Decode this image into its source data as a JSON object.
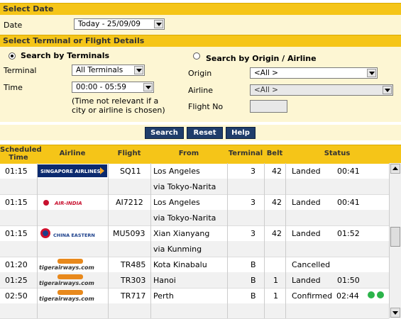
{
  "select_date": {
    "header": "Select Date",
    "date_label": "Date",
    "date_value": "Today - 25/09/09"
  },
  "terminal_section": {
    "header": "Select Terminal or Flight Details",
    "by_terminals_label": "Search by Terminals",
    "by_origin_label": "Search by Origin / Airline",
    "terminal_label": "Terminal",
    "terminal_value": "All Terminals",
    "time_label": "Time",
    "time_value": "00:00 - 05:59",
    "note_line1": "(Time not relevant if a",
    "note_line2": "city or airline is chosen)",
    "origin_label": "Origin",
    "origin_value": "<All >",
    "airline_label": "Airline",
    "airline_value": "<All >",
    "flight_no_label": "Flight No"
  },
  "buttons": {
    "search": "Search",
    "reset": "Reset",
    "help": "Help"
  },
  "table": {
    "headers": {
      "scheduled": "Scheduled",
      "time": "Time",
      "airline": "Airline",
      "flight": "Flight",
      "from": "From",
      "terminal": "Terminal",
      "belt": "Belt",
      "status": "Status"
    },
    "rows": [
      {
        "time": "01:15",
        "airline": "SINGAPORE AIRLINES",
        "flight": "SQ11",
        "from": "Los Angeles",
        "terminal": "3",
        "belt": "42",
        "status": "Landed",
        "status_time": "00:41"
      },
      {
        "via": "via Tokyo-Narita"
      },
      {
        "time": "01:15",
        "airline": "AIR-INDIA",
        "flight": "AI7212",
        "from": "Los Angeles",
        "terminal": "3",
        "belt": "42",
        "status": "Landed",
        "status_time": "00:41"
      },
      {
        "via": "via Tokyo-Narita"
      },
      {
        "time": "01:15",
        "airline": "CHINA EASTERN",
        "flight": "MU5093",
        "from": "Xian Xianyang",
        "terminal": "3",
        "belt": "42",
        "status": "Landed",
        "status_time": "01:52"
      },
      {
        "via": "via Kunming"
      },
      {
        "time": "01:20",
        "airline": "tigerairways.com",
        "flight": "TR485",
        "from": "Kota Kinabalu",
        "terminal": "B",
        "belt": "",
        "status": "Cancelled",
        "status_time": ""
      },
      {
        "time": "01:25",
        "airline": "tigerairways.com",
        "flight": "TR303",
        "from": "Hanoi",
        "terminal": "B",
        "belt": "1",
        "status": "Landed",
        "status_time": "01:50"
      },
      {
        "time": "02:50",
        "airline": "tigerairways.com",
        "flight": "TR717",
        "from": "Perth",
        "terminal": "B",
        "belt": "1",
        "status": "Confirmed",
        "status_time": "02:44"
      }
    ]
  },
  "colors": {
    "header": "#f5c518",
    "panel": "#fdf6d3",
    "button": "#1f3d6b",
    "status_dot": "#2bb34a"
  }
}
